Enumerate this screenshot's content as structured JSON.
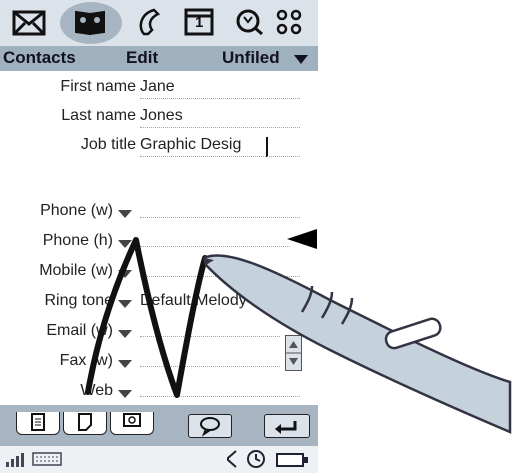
{
  "topbar": {
    "icons": [
      "mail-icon",
      "contacts-book-icon",
      "phone-handset-icon",
      "calendar-icon",
      "search-icon",
      "apps-grid-icon"
    ],
    "calendar_day": "1",
    "active_icon": "contacts-book-icon"
  },
  "menubar": {
    "contacts": "Contacts",
    "edit": "Edit",
    "folder": "Unfiled"
  },
  "form": {
    "first_name_label": "First name",
    "first_name_value": "Jane",
    "last_name_label": "Last name",
    "last_name_value": "Jones",
    "job_title_label": "Job title",
    "job_title_value": "Graphic Desig",
    "fields": [
      {
        "label": "Phone (w)",
        "value": ""
      },
      {
        "label": "Phone (h)",
        "value": ""
      },
      {
        "label": "Mobile (w)",
        "value": ""
      },
      {
        "label": "Ring tone",
        "value": "Default Melody"
      },
      {
        "label": "Email (w)",
        "value": ""
      },
      {
        "label": "Fax (w)",
        "value": ""
      },
      {
        "label": "Web",
        "value": ""
      }
    ]
  },
  "bottombar": {
    "tabs": [
      "list-tab-icon",
      "note-tab-icon",
      "photo-tab-icon"
    ],
    "buttons": [
      "speech-bubble-icon",
      "back-arrow-icon"
    ]
  },
  "statusbar": {
    "icons": [
      "signal-icon",
      "keyboard-icon",
      "speaker-icon",
      "clock-icon",
      "battery-icon"
    ]
  },
  "colors": {
    "topbar": "#dbe2ea",
    "menubar": "#9fb0bf",
    "accent_dark": "#112233",
    "stylus": "#c5d2dc"
  }
}
